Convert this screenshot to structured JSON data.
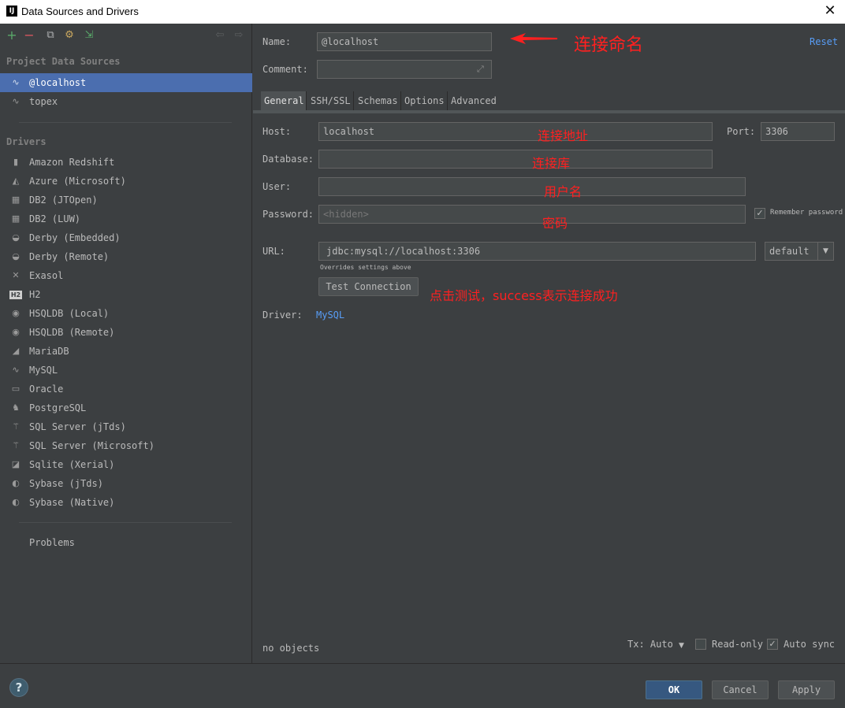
{
  "window": {
    "title": "Data Sources and Drivers",
    "app_icon": "IJ"
  },
  "toolbar": {
    "add": "+",
    "remove": "−",
    "duplicate": "⧉",
    "settings": "⚙",
    "import": "⇲",
    "back": "⇦",
    "forward": "⇨"
  },
  "left": {
    "project_title": "Project Data Sources",
    "project_items": [
      {
        "label": "@localhost",
        "icon": "mysql-icon"
      },
      {
        "label": "topex",
        "icon": "mysql-icon"
      }
    ],
    "drivers_title": "Drivers",
    "drivers": [
      {
        "label": "Amazon Redshift",
        "glyph": "▮"
      },
      {
        "label": "Azure (Microsoft)",
        "glyph": "◭"
      },
      {
        "label": "DB2 (JTOpen)",
        "glyph": "▦"
      },
      {
        "label": "DB2 (LUW)",
        "glyph": "▦"
      },
      {
        "label": "Derby (Embedded)",
        "glyph": "◒"
      },
      {
        "label": "Derby (Remote)",
        "glyph": "◒"
      },
      {
        "label": "Exasol",
        "glyph": "✕"
      },
      {
        "label": "H2",
        "glyph": "H2"
      },
      {
        "label": "HSQLDB (Local)",
        "glyph": "◉"
      },
      {
        "label": "HSQLDB (Remote)",
        "glyph": "◉"
      },
      {
        "label": "MariaDB",
        "glyph": "◢"
      },
      {
        "label": "MySQL",
        "glyph": "∿"
      },
      {
        "label": "Oracle",
        "glyph": "▭"
      },
      {
        "label": "PostgreSQL",
        "glyph": "♞"
      },
      {
        "label": "SQL Server (jTds)",
        "glyph": "⚚"
      },
      {
        "label": "SQL Server (Microsoft)",
        "glyph": "⚚"
      },
      {
        "label": "Sqlite (Xerial)",
        "glyph": "◪"
      },
      {
        "label": "Sybase (jTds)",
        "glyph": "◐"
      },
      {
        "label": "Sybase (Native)",
        "glyph": "◐"
      }
    ],
    "problems": "Problems"
  },
  "form": {
    "name_label": "Name:",
    "name_value": "@localhost",
    "reset": "Reset",
    "comment_label": "Comment:",
    "comment_value": "",
    "tabs": [
      "General",
      "SSH/SSL",
      "Schemas",
      "Options",
      "Advanced"
    ],
    "host_label": "Host:",
    "host_value": "localhost",
    "port_label": "Port:",
    "port_value": "3306",
    "database_label": "Database:",
    "database_value": "",
    "user_label": "User:",
    "user_value": "",
    "password_label": "Password:",
    "password_placeholder": "<hidden>",
    "remember_password": "Remember password",
    "url_label": "URL:",
    "url_value": "jdbc:mysql://localhost:3306",
    "url_mode": "default",
    "overrides_note": "Overrides settings above",
    "test_connection": "Test Connection",
    "driver_label": "Driver:",
    "driver_value": "MySQL",
    "status": "no objects",
    "tx_label": "Tx: Auto",
    "readonly_label": "Read-only",
    "autosync_label": "Auto sync"
  },
  "annotations": {
    "name": "连接命名",
    "host": "连接地址",
    "database": "连接库",
    "user": "用户名",
    "password": "密码",
    "test": "点击测试，success表示连接成功"
  },
  "buttons": {
    "ok": "OK",
    "cancel": "Cancel",
    "apply": "Apply",
    "help": "?"
  },
  "colors": {
    "accent": "#4b6eaf",
    "link": "#589df6",
    "annotation": "#ff2020",
    "primary_button": "#365880"
  }
}
